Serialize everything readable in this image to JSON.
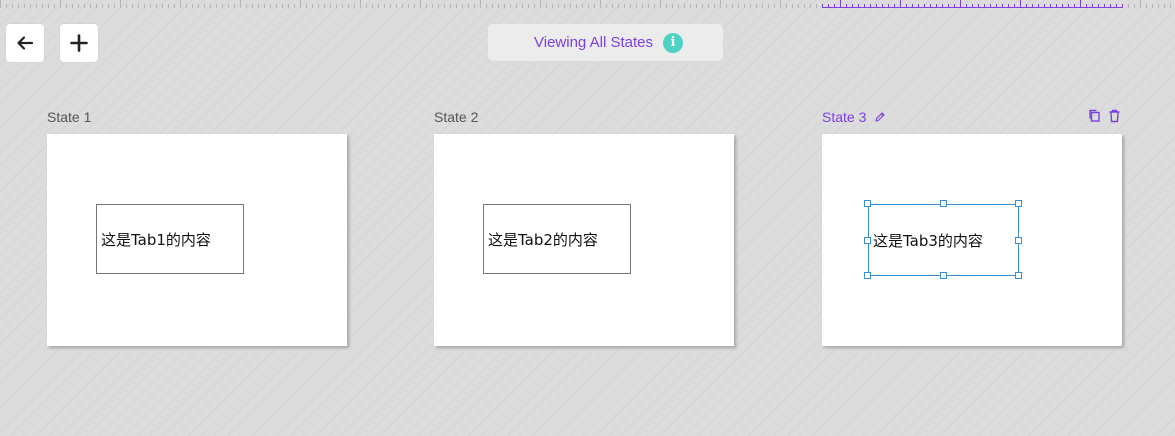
{
  "toolbar": {
    "back_icon": "arrow-left-icon",
    "add_icon": "plus-icon"
  },
  "status": {
    "text": "Viewing All States",
    "icon": "info-icon",
    "icon_glyph": "i",
    "accent_color": "#7b3fe4",
    "icon_color": "#4fd1c5"
  },
  "states": [
    {
      "label": "State 1",
      "content": "这是Tab1的内容",
      "active": false
    },
    {
      "label": "State 2",
      "content": "这是Tab2的内容",
      "active": false
    },
    {
      "label": "State 3",
      "content": "这是Tab3的内容",
      "active": true
    }
  ],
  "state_actions": {
    "edit_icon": "pencil-icon",
    "duplicate_icon": "duplicate-icon",
    "delete_icon": "trash-icon"
  },
  "selection_color": "#3a8fd0"
}
